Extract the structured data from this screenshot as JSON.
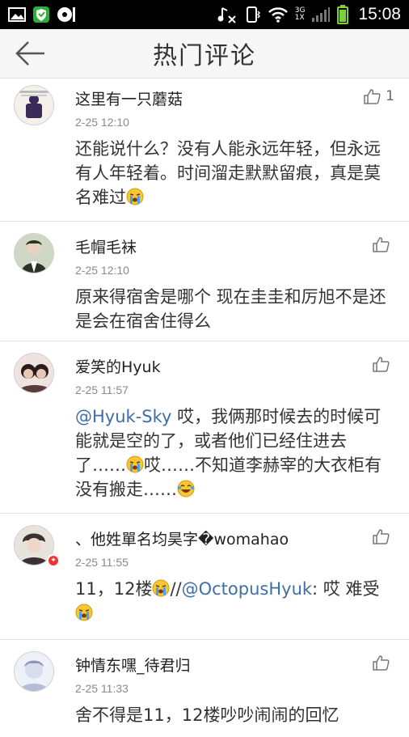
{
  "status_bar": {
    "time": "15:08",
    "network_top": "3G",
    "network_bottom": "1X",
    "icons": [
      "image-icon",
      "shield-app-icon",
      "disc-icon",
      "music-off-icon",
      "phone-vibrate-icon",
      "wifi-icon",
      "signal-icon",
      "battery-icon"
    ]
  },
  "header": {
    "title": "热门评论",
    "back_icon": "arrow-left-icon"
  },
  "comments": [
    {
      "username": "这里有一只蘑菇",
      "time": "2-25 12:10",
      "like_count": "1",
      "avatar_colors": [
        "#f4f1ea",
        "#3b2a57"
      ],
      "segments": [
        {
          "type": "text",
          "text": "还能说什么？没有人能永远年轻，但永远有人年轻着。时间溜走默默留痕，真是莫名难过"
        },
        {
          "type": "emoji",
          "name": "crying-emoji"
        }
      ]
    },
    {
      "username": "毛帽毛袜",
      "time": "2-25 12:10",
      "like_count": "",
      "avatar_colors": [
        "#cfd8c4",
        "#2b3326"
      ],
      "segments": [
        {
          "type": "text",
          "text": "原来得宿舍是哪个 现在圭圭和厉旭不是还是会在宿舍住得么"
        }
      ]
    },
    {
      "username": "爱笑的Hyuk",
      "time": "2-25 11:57",
      "like_count": "",
      "avatar_colors": [
        "#efe3df",
        "#2a1c1c"
      ],
      "segments": [
        {
          "type": "mention",
          "text": "@Hyuk-Sky"
        },
        {
          "type": "text",
          "text": " 哎，我俩那时候去的时候可能就是空的了，或者他们已经住进去了……"
        },
        {
          "type": "emoji",
          "name": "crying-emoji"
        },
        {
          "type": "text",
          "text": "哎……不知道李赫宰的大衣柜有没有搬走……"
        },
        {
          "type": "emoji",
          "name": "laughing-emoji"
        }
      ]
    },
    {
      "username": "、他姓單名均昊字�womahao",
      "time": "2-25 11:55",
      "like_count": "",
      "avatar_colors": [
        "#e8e4dd",
        "#3a3232"
      ],
      "badge": true,
      "segments": [
        {
          "type": "text",
          "text": "11，12楼"
        },
        {
          "type": "emoji",
          "name": "crying-emoji"
        },
        {
          "type": "text",
          "text": "//"
        },
        {
          "type": "mention",
          "text": "@OctopusHyuk"
        },
        {
          "type": "text",
          "text": ": 哎 难受"
        },
        {
          "type": "emoji",
          "name": "crying-emoji"
        }
      ]
    },
    {
      "username": "钟情东嘿_待君归",
      "time": "2-25 11:33",
      "like_count": "",
      "avatar_colors": [
        "#eef1f7",
        "#8d97b5"
      ],
      "segments": [
        {
          "type": "text",
          "text": "舍不得是11，12楼吵吵闹闹的回忆"
        }
      ]
    }
  ]
}
